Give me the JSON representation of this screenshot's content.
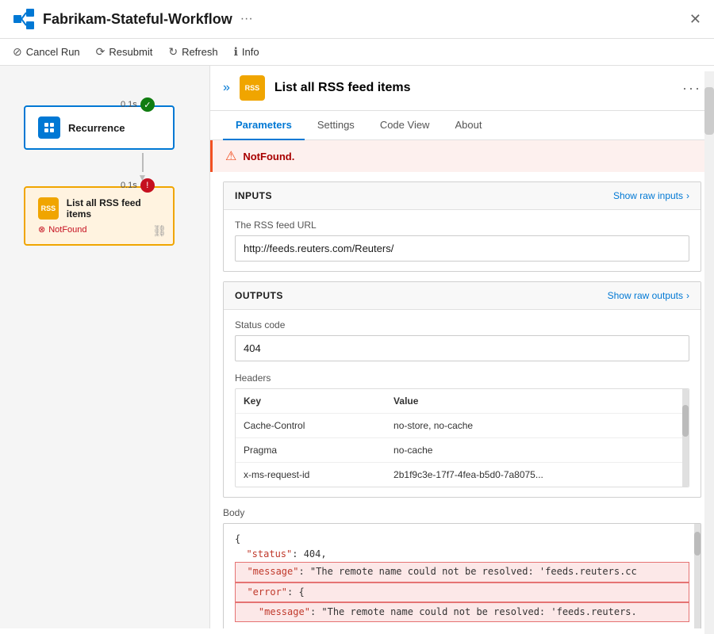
{
  "titleBar": {
    "icon": "workflow-icon",
    "title": "Fabrikam-Stateful-Workflow",
    "ellipsis": "···",
    "close": "✕"
  },
  "toolbar": {
    "cancelRun": "Cancel Run",
    "resubmit": "Resubmit",
    "refresh": "Refresh",
    "info": "Info"
  },
  "workflowNodes": {
    "recurrence": {
      "label": "Recurrence",
      "timing": "0.1s",
      "status": "success"
    },
    "rss": {
      "label": "List all RSS feed items",
      "timing": "0.1s",
      "status": "error",
      "errorText": "NotFound"
    }
  },
  "rightPanel": {
    "title": "List all RSS feed items",
    "tabs": [
      "Parameters",
      "Settings",
      "Code View",
      "About"
    ],
    "activeTab": "Parameters",
    "errorBanner": "NotFound.",
    "inputs": {
      "sectionTitle": "INPUTS",
      "showRaw": "Show raw inputs",
      "rssLabel": "The RSS feed URL",
      "rssUrl": "http://feeds.reuters.com/Reuters/"
    },
    "outputs": {
      "sectionTitle": "OUTPUTS",
      "showRaw": "Show raw outputs",
      "statusCodeLabel": "Status code",
      "statusCodeValue": "404",
      "headersLabel": "Headers",
      "tableHeaders": [
        "Key",
        "Value"
      ],
      "headerRows": [
        {
          "key": "Cache-Control",
          "value": "no-store, no-cache"
        },
        {
          "key": "Pragma",
          "value": "no-cache"
        },
        {
          "key": "x-ms-request-id",
          "value": "2b1f9c3e-17f7-4fea-b5d0-7a8075..."
        }
      ],
      "bodyLabel": "Body",
      "bodyCode": [
        {
          "text": "{",
          "highlighted": false
        },
        {
          "text": "  \"status\": 404,",
          "highlighted": false
        },
        {
          "text": "  \"message\": \"The remote name could not be resolved: 'feeds.reuters.cc",
          "highlighted": true
        },
        {
          "text": "  \"error\": {",
          "highlighted": true
        },
        {
          "text": "    \"message\": \"The remote name could not be resolved: 'feeds.reuters.",
          "highlighted": true
        }
      ]
    }
  }
}
